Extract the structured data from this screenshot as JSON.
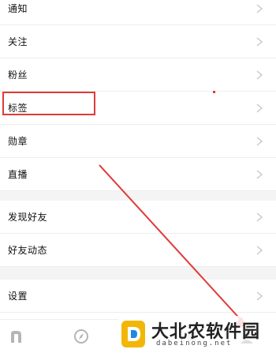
{
  "settings_list": {
    "items": [
      {
        "label": "通知"
      },
      {
        "label": "关注"
      },
      {
        "label": "粉丝"
      },
      {
        "label": "标签"
      },
      {
        "label": "勋章"
      },
      {
        "label": "直播"
      },
      {
        "label": "发现好友"
      },
      {
        "label": "好友动态"
      },
      {
        "label": "设置"
      }
    ]
  },
  "annotation": {
    "color": "#e03a3a",
    "highlighted_item": "标签"
  },
  "tab_bar": {
    "tabs": [
      {
        "icon": "app-logo-icon"
      },
      {
        "icon": "compass-icon"
      },
      {
        "icon": "tab-icon"
      },
      {
        "icon": "profile-icon"
      }
    ]
  },
  "watermark": {
    "text": "大北农软件园",
    "subtext": "dabeinong.net"
  }
}
